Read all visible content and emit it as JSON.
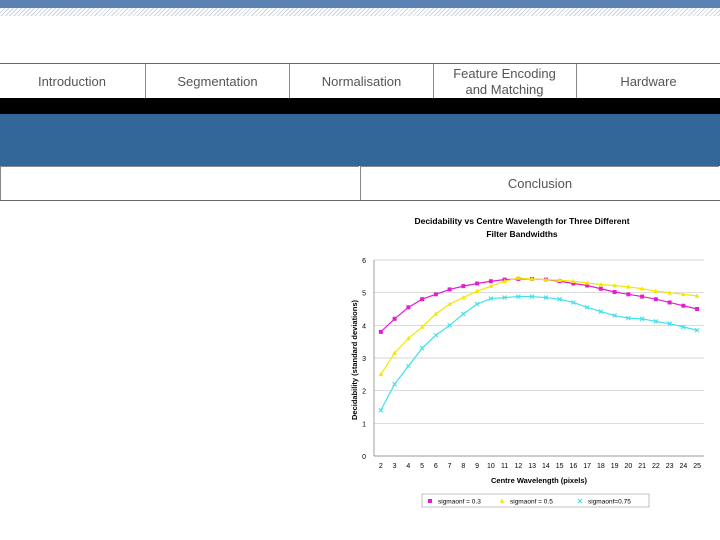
{
  "nav": {
    "items": [
      {
        "label": "Introduction"
      },
      {
        "label": "Segmentation"
      },
      {
        "label": "Normalisation"
      },
      {
        "label": "Feature Encoding and Matching"
      },
      {
        "label": "Hardware"
      }
    ]
  },
  "subnav": {
    "items": [
      {
        "label": ""
      },
      {
        "label": "Conclusion"
      }
    ]
  },
  "chart_data": {
    "type": "line",
    "title": "Decidability vs Centre Wavelength for Three Different Filter Bandwidths",
    "xlabel": "Centre Wavelength (pixels)",
    "ylabel": "Decidability (standard deviations)",
    "x": [
      2,
      3,
      4,
      5,
      6,
      7,
      8,
      9,
      10,
      11,
      12,
      13,
      14,
      15,
      16,
      17,
      18,
      19,
      20,
      21,
      22,
      23,
      24,
      25
    ],
    "ylim": [
      0,
      6
    ],
    "yticks": [
      0,
      1,
      2,
      3,
      4,
      5,
      6
    ],
    "grid": true,
    "legend": "bottom",
    "series": [
      {
        "name": "sigmaonf = 0.3",
        "color": "#e020d0",
        "marker": "square",
        "values": [
          3.8,
          4.2,
          4.55,
          4.8,
          4.95,
          5.1,
          5.2,
          5.28,
          5.35,
          5.4,
          5.42,
          5.42,
          5.4,
          5.35,
          5.28,
          5.22,
          5.12,
          5.02,
          4.95,
          4.88,
          4.8,
          4.7,
          4.6,
          4.5
        ]
      },
      {
        "name": "sigmaonf = 0.5",
        "color": "#f2e800",
        "marker": "triangle",
        "values": [
          2.5,
          3.15,
          3.6,
          3.95,
          4.35,
          4.65,
          4.85,
          5.05,
          5.2,
          5.35,
          5.45,
          5.42,
          5.4,
          5.38,
          5.35,
          5.3,
          5.25,
          5.22,
          5.18,
          5.12,
          5.05,
          5.0,
          4.95,
          4.9
        ]
      },
      {
        "name": "sigmaonf=0.75",
        "color": "#40e0e8",
        "marker": "x",
        "values": [
          1.4,
          2.2,
          2.75,
          3.3,
          3.7,
          4.0,
          4.35,
          4.65,
          4.82,
          4.85,
          4.88,
          4.88,
          4.85,
          4.8,
          4.7,
          4.55,
          4.42,
          4.3,
          4.22,
          4.2,
          4.12,
          4.05,
          3.95,
          3.85
        ]
      }
    ]
  }
}
